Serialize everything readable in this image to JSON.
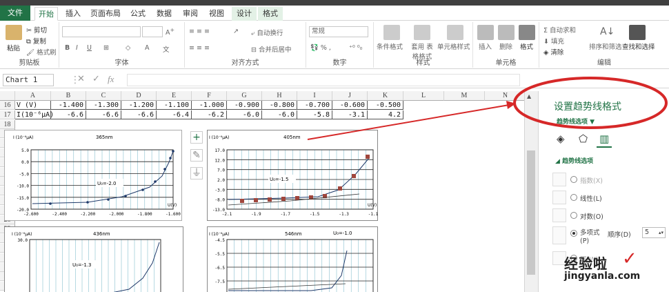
{
  "tabs": [
    {
      "label": "文件"
    },
    {
      "label": "开始"
    },
    {
      "label": "插入"
    },
    {
      "label": "页面布局"
    },
    {
      "label": "公式"
    },
    {
      "label": "数据"
    },
    {
      "label": "审阅"
    },
    {
      "label": "视图"
    },
    {
      "label": "设计"
    },
    {
      "label": "格式"
    }
  ],
  "ribbon": {
    "paste": "粘贴",
    "cut": "剪切",
    "copy": "复制",
    "format_painter": "格式刷",
    "clipboard": "剪贴板",
    "font": "字体",
    "alignment": "对齐方式",
    "wrap_text": "自动换行",
    "merge_center": "合并后居中",
    "number_format": "常规",
    "number": "数字",
    "conditional_format": "条件格式",
    "table_format": "套用 表格格式",
    "cell_style": "单元格样式",
    "styles": "样式",
    "insert": "插入",
    "delete": "删除",
    "format": "格式",
    "cells": "单元格",
    "autosum": "自动求和",
    "fill": "填充",
    "clear": "清除",
    "sort_filter": "排序和筛选",
    "find_select": "查找和选择",
    "editing": "编辑"
  },
  "formula_bar": {
    "name_box": "Chart 1",
    "fx": "fx"
  },
  "columns": [
    "A",
    "B",
    "C",
    "D",
    "E",
    "F",
    "G",
    "H",
    "I",
    "J",
    "K",
    "L",
    "M",
    "N",
    "O"
  ],
  "rows": [
    "16",
    "17",
    "18",
    "19",
    "20",
    "21",
    "22",
    "23",
    "24",
    "25",
    "26",
    "27",
    "28",
    "29",
    "30",
    "31",
    "32",
    "33",
    "34",
    "35"
  ],
  "table": {
    "row16_label": "V (V)",
    "row16": [
      "-1.400",
      "-1.300",
      "-1.200",
      "-1.100",
      "-1.000",
      "-0.900",
      "-0.800",
      "-0.700",
      "-0.600",
      "-0.500"
    ],
    "row17_label": "I(10⁻⁶μA)",
    "row17": [
      "-6.6",
      "-6.6",
      "-6.6",
      "-6.4",
      "-6.2",
      "-6.0",
      "-6.0",
      "-5.8",
      "-3.1",
      "4.2"
    ]
  },
  "charts": {
    "c1": {
      "title": "365nm",
      "ylabel": "I (10⁻⁶μA)",
      "annot": "U₀=-2.0",
      "xlabel": "U(V)",
      "yticks": [
        "5.0",
        "0.0",
        "-5.0",
        "-10.0",
        "-15.0",
        "-20.0"
      ],
      "xticks": [
        "-2.600",
        "-2.400",
        "-2.200",
        "-2.000",
        "-1.800",
        "-1.600"
      ]
    },
    "c2": {
      "title": "405nm",
      "ylabel": "I (10⁻⁶μA)",
      "annot": "U₀=-1.5",
      "xlabel": "U(V)",
      "yticks": [
        "17.0",
        "12.0",
        "7.0",
        "2.0",
        "-3.0",
        "-8.0",
        "-13.0"
      ],
      "xticks": [
        "-2.1",
        "-1.9",
        "-1.7",
        "-1.5",
        "-1.3",
        "-1.1"
      ]
    },
    "c3": {
      "title": "436nm",
      "ylabel": "I (10⁻⁶μA)",
      "annot": "U₀=-1.3",
      "yticks": [
        "30.0",
        "25.0"
      ]
    },
    "c4": {
      "title": "546nm",
      "ylabel": "I (10⁻⁶μA)",
      "annot": "U₀=-1.0",
      "yticks": [
        "-4.5",
        "-5.5",
        "-6.5",
        "-7.5",
        "-8.5"
      ]
    }
  },
  "pane": {
    "title": "设置趋势线格式",
    "subtitle": "趋势线选项",
    "section": "趋势线选项",
    "options": [
      {
        "label": "指数(X)",
        "checked": false,
        "disabled": true
      },
      {
        "label": "线性(L)",
        "checked": false,
        "disabled": false
      },
      {
        "label": "对数(O)",
        "checked": false,
        "disabled": false
      },
      {
        "label": "多项式(P)",
        "checked": true,
        "disabled": false
      },
      {
        "label": "幂(W)",
        "checked": false,
        "disabled": true
      }
    ],
    "order_label": "顺序(D)",
    "order_value": "5"
  },
  "watermark": {
    "text": "经验啦",
    "url": "jingyanla.com",
    "check": "✓"
  },
  "colors": {
    "accent": "#217346",
    "annotation": "#d62828",
    "trend_marker": "#a0463c"
  }
}
